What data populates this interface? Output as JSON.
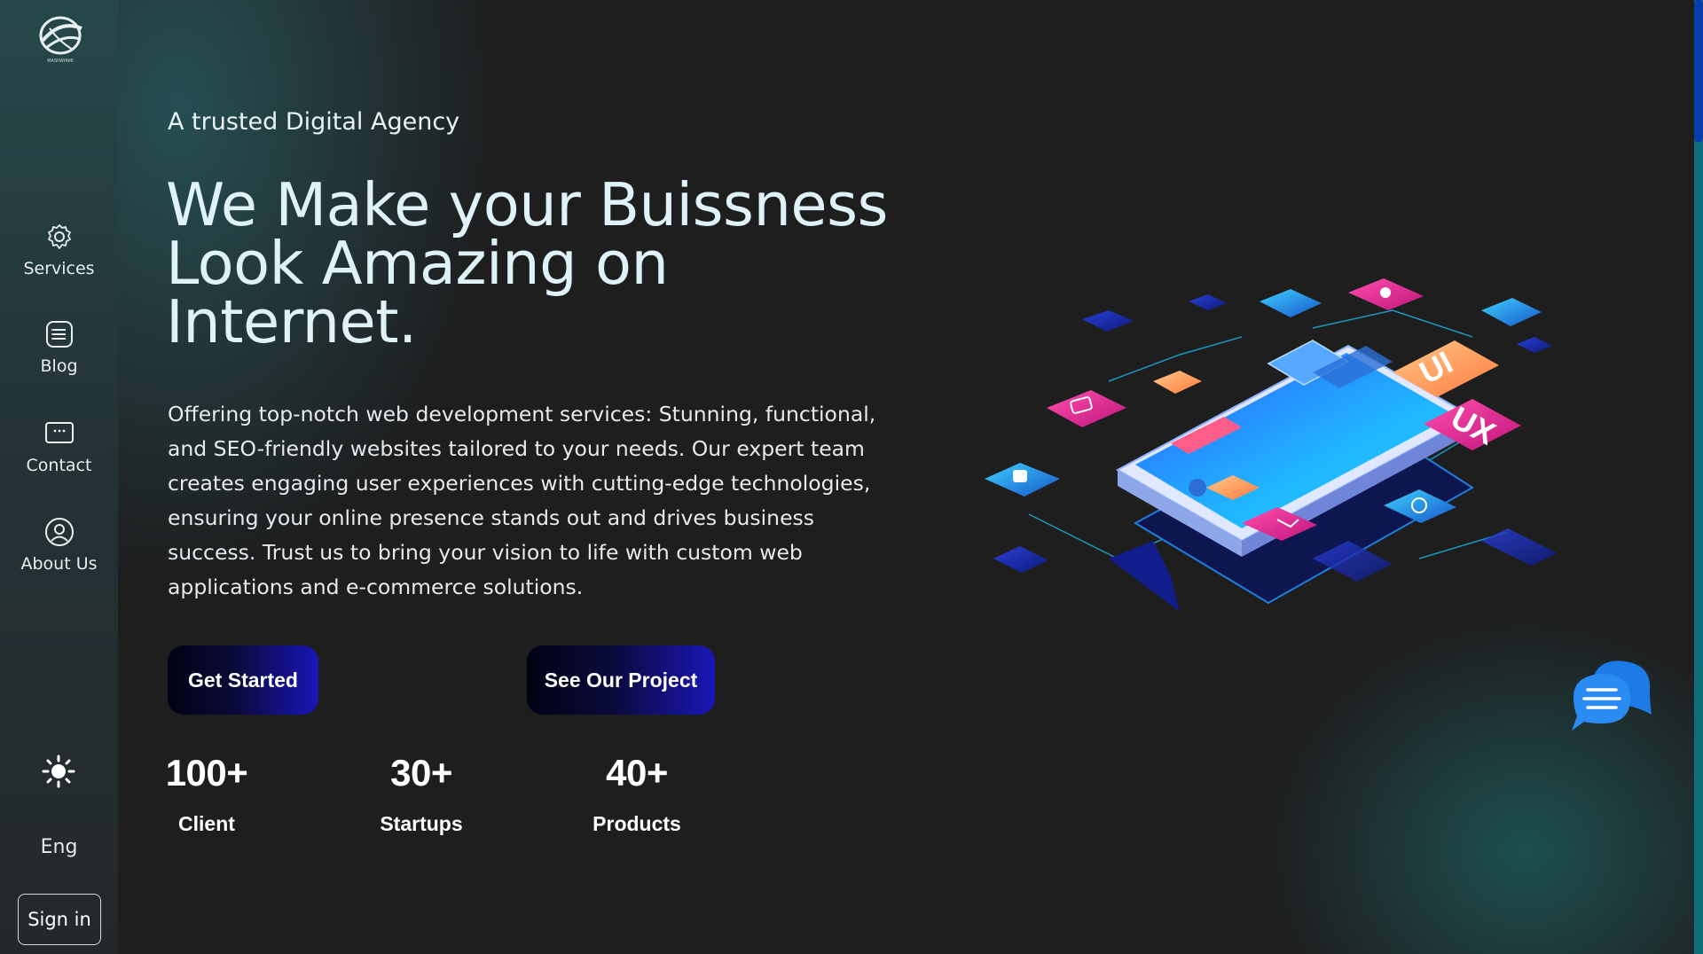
{
  "sidebar": {
    "logo_text": "MASHAYAMI",
    "items": [
      {
        "label": "Services",
        "icon": "gear-icon"
      },
      {
        "label": "Blog",
        "icon": "list-icon"
      },
      {
        "label": "Contact",
        "icon": "message-icon"
      },
      {
        "label": "About Us",
        "icon": "user-icon"
      }
    ],
    "theme_icon": "sun-icon",
    "language": "Eng",
    "signin_label": "Sign in"
  },
  "hero": {
    "tagline": "A trusted Digital Agency",
    "headline": "We Make your Buissness Look Amazing on Internet.",
    "description": "Offering top-notch web development services: Stunning, functional, and SEO-friendly websites tailored to your needs. Our expert team creates engaging user experiences with cutting-edge technologies, ensuring your online presence stands out and drives business success. Trust us to bring your vision to life with custom web applications and e-commerce solutions.",
    "primary_button": "Get Started",
    "secondary_button": "See Our Project",
    "stats": [
      {
        "value": "100+",
        "label": "Client"
      },
      {
        "value": "30+",
        "label": "Startups"
      },
      {
        "value": "40+",
        "label": "Products"
      }
    ]
  },
  "illustration": {
    "badge_ui": "UI",
    "badge_ux": "UX"
  },
  "chat": {
    "icon": "chat-icon"
  },
  "colors": {
    "accent": "#1a16b8",
    "background": "#1e1e1f",
    "sidebar": "#233336",
    "teal_glow": "#1b7878"
  }
}
